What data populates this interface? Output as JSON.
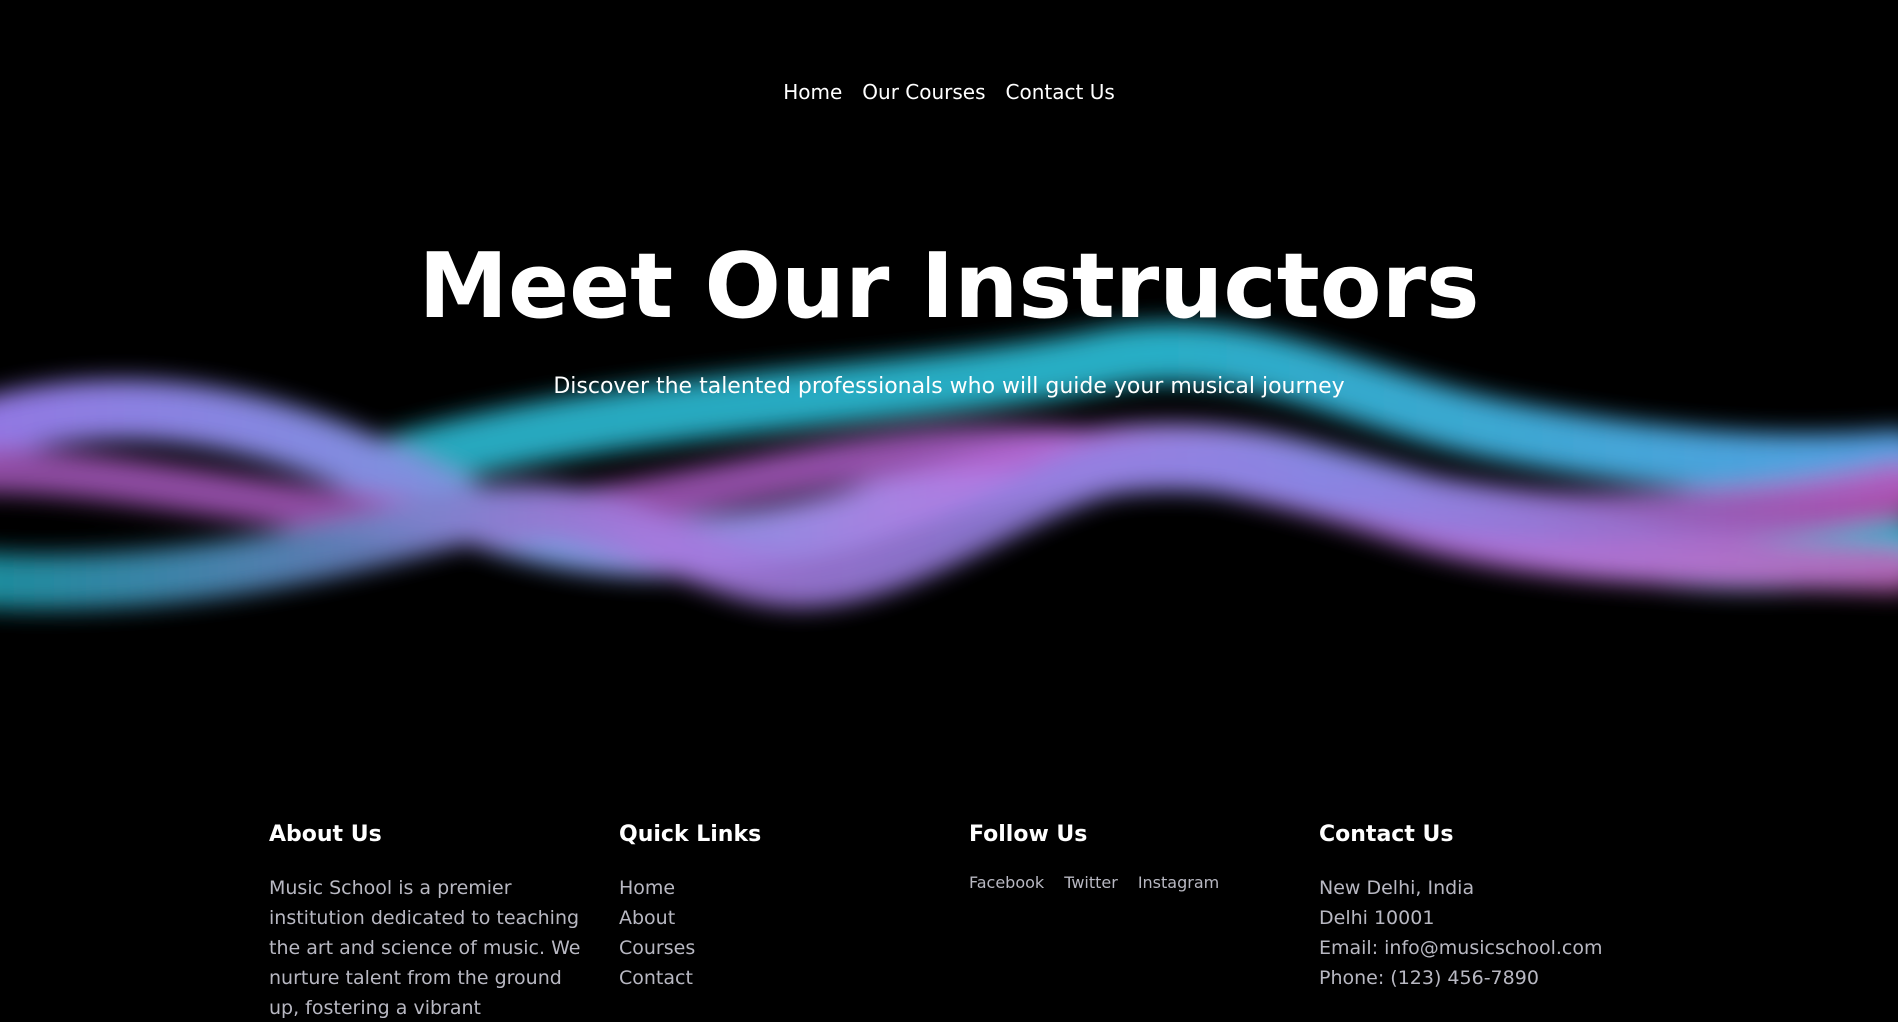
{
  "nav": {
    "items": [
      {
        "label": "Home"
      },
      {
        "label": "Our Courses"
      },
      {
        "label": "Contact Us"
      }
    ]
  },
  "hero": {
    "title": "Meet Our Instructors",
    "subtitle": "Discover the talented professionals who will guide your musical journey"
  },
  "footer": {
    "about": {
      "heading": "About Us",
      "text": "Music School is a premier institution dedicated to teaching the art and science of music. We nurture talent from the ground up, fostering a vibrant"
    },
    "quick_links": {
      "heading": "Quick Links",
      "items": [
        "Home",
        "About",
        "Courses",
        "Contact"
      ]
    },
    "follow": {
      "heading": "Follow Us",
      "items": [
        "Facebook",
        "Twitter",
        "Instagram"
      ]
    },
    "contact": {
      "heading": "Contact Us",
      "lines": [
        "New Delhi, India",
        "Delhi 10001",
        "Email: info@musicschool.com",
        "Phone: (123) 456-7890"
      ]
    }
  },
  "colors": {
    "background": "#000000",
    "wave_cyan": "#22b8d0",
    "wave_violet": "#b57ef0",
    "wave_magenta": "#c25ecf",
    "muted_text": "#b8b8c2"
  }
}
